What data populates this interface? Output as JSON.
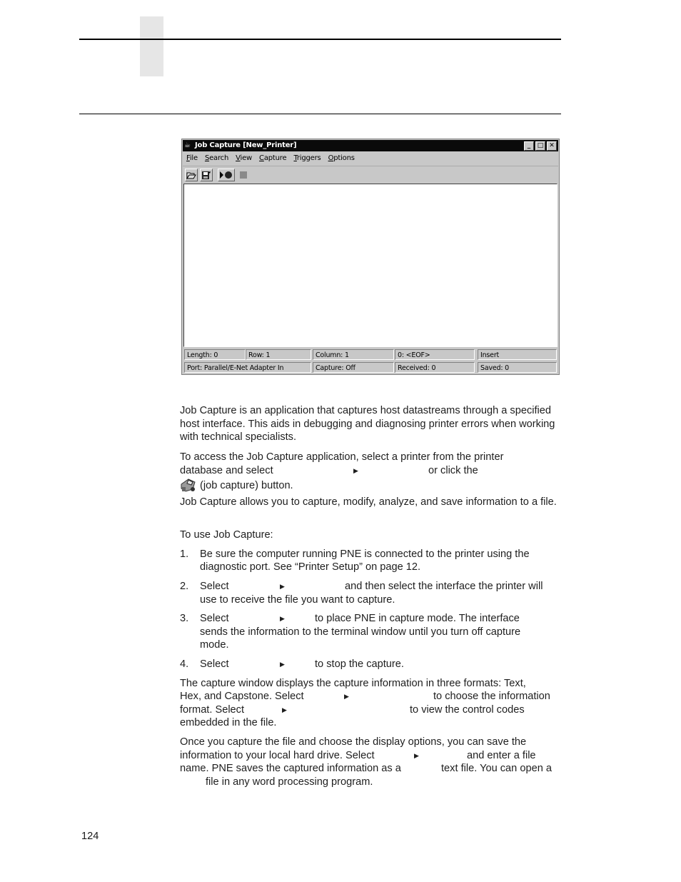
{
  "page": {
    "number": "124"
  },
  "window": {
    "title": "Job Capture [New_Printer]",
    "controls": [
      "minimize",
      "maximize",
      "close"
    ],
    "menu": [
      {
        "label": "File",
        "mnemonic": "F"
      },
      {
        "label": "Search",
        "mnemonic": "S"
      },
      {
        "label": "View",
        "mnemonic": "V"
      },
      {
        "label": "Capture",
        "mnemonic": "C"
      },
      {
        "label": "Triggers",
        "mnemonic": "T"
      },
      {
        "label": "Options",
        "mnemonic": "O"
      }
    ],
    "toolbar": [
      {
        "name": "open-file",
        "icon": "folder-open-icon"
      },
      {
        "name": "save-file",
        "icon": "save-icon"
      },
      {
        "name": "start-capture",
        "icon": "play-record-icon"
      },
      {
        "name": "stop-capture",
        "icon": "stop-icon",
        "disabled": true
      }
    ],
    "status": {
      "length": "Length: 0",
      "row": "Row: 1",
      "column": "Column: 1",
      "position": "0: <EOF>",
      "mode": "Insert",
      "port": "Port: Parallel/E-Net Adapter In",
      "capture": "Capture: Off",
      "received": "Received: 0",
      "saved": "Saved: 0"
    }
  },
  "text": {
    "p1": "Job Capture is an application that captures host datastreams through a specified host interface. This aids in debugging and diagnosing printer errors when working with technical specialists.",
    "p2_line1": "To access the Job Capture application, select a printer from the printer",
    "p2_line2a": "database and select",
    "p2_line2b": "or click the",
    "p2_line3": "(job capture) button.",
    "p3": "Job Capture allows you to capture, modify, analyze, and save information to a file.",
    "p4": "To use Job Capture:",
    "steps": [
      {
        "num": "1.",
        "line1": "Be sure the computer running PNE is connected to the printer using the",
        "line2": "diagnostic port. See “Printer Setup” on page 12."
      },
      {
        "num": "2.",
        "line1a": "Select",
        "line1b": "and then select the interface the printer will",
        "line2": "use to receive the file you want to capture."
      },
      {
        "num": "3.",
        "line1a": "Select",
        "line1b": "to place PNE in capture mode. The interface",
        "line2": "sends the information to the terminal window until you turn off capture",
        "line3": "mode."
      },
      {
        "num": "4.",
        "line1a": "Select",
        "line1b": "to stop the capture."
      }
    ],
    "p5_line1": "The capture window displays the capture information in three formats: Text,",
    "p5_line2a": "Hex, and Capstone. Select",
    "p5_line2b": "to choose the information",
    "p5_line3a": "format. Select",
    "p5_line3b": "to view the control codes",
    "p5_line4": "embedded in the file.",
    "p6_line1": "Once you capture the file and choose the display options, you can save the",
    "p6_line2a": "information to your local hard drive. Select",
    "p6_line2b": "and enter a file",
    "p6_line3a": "name. PNE saves the captured information as a",
    "p6_line3b": "text file. You can open a",
    "p6_line4": "file in any word processing program.",
    "arrow": "▶"
  }
}
